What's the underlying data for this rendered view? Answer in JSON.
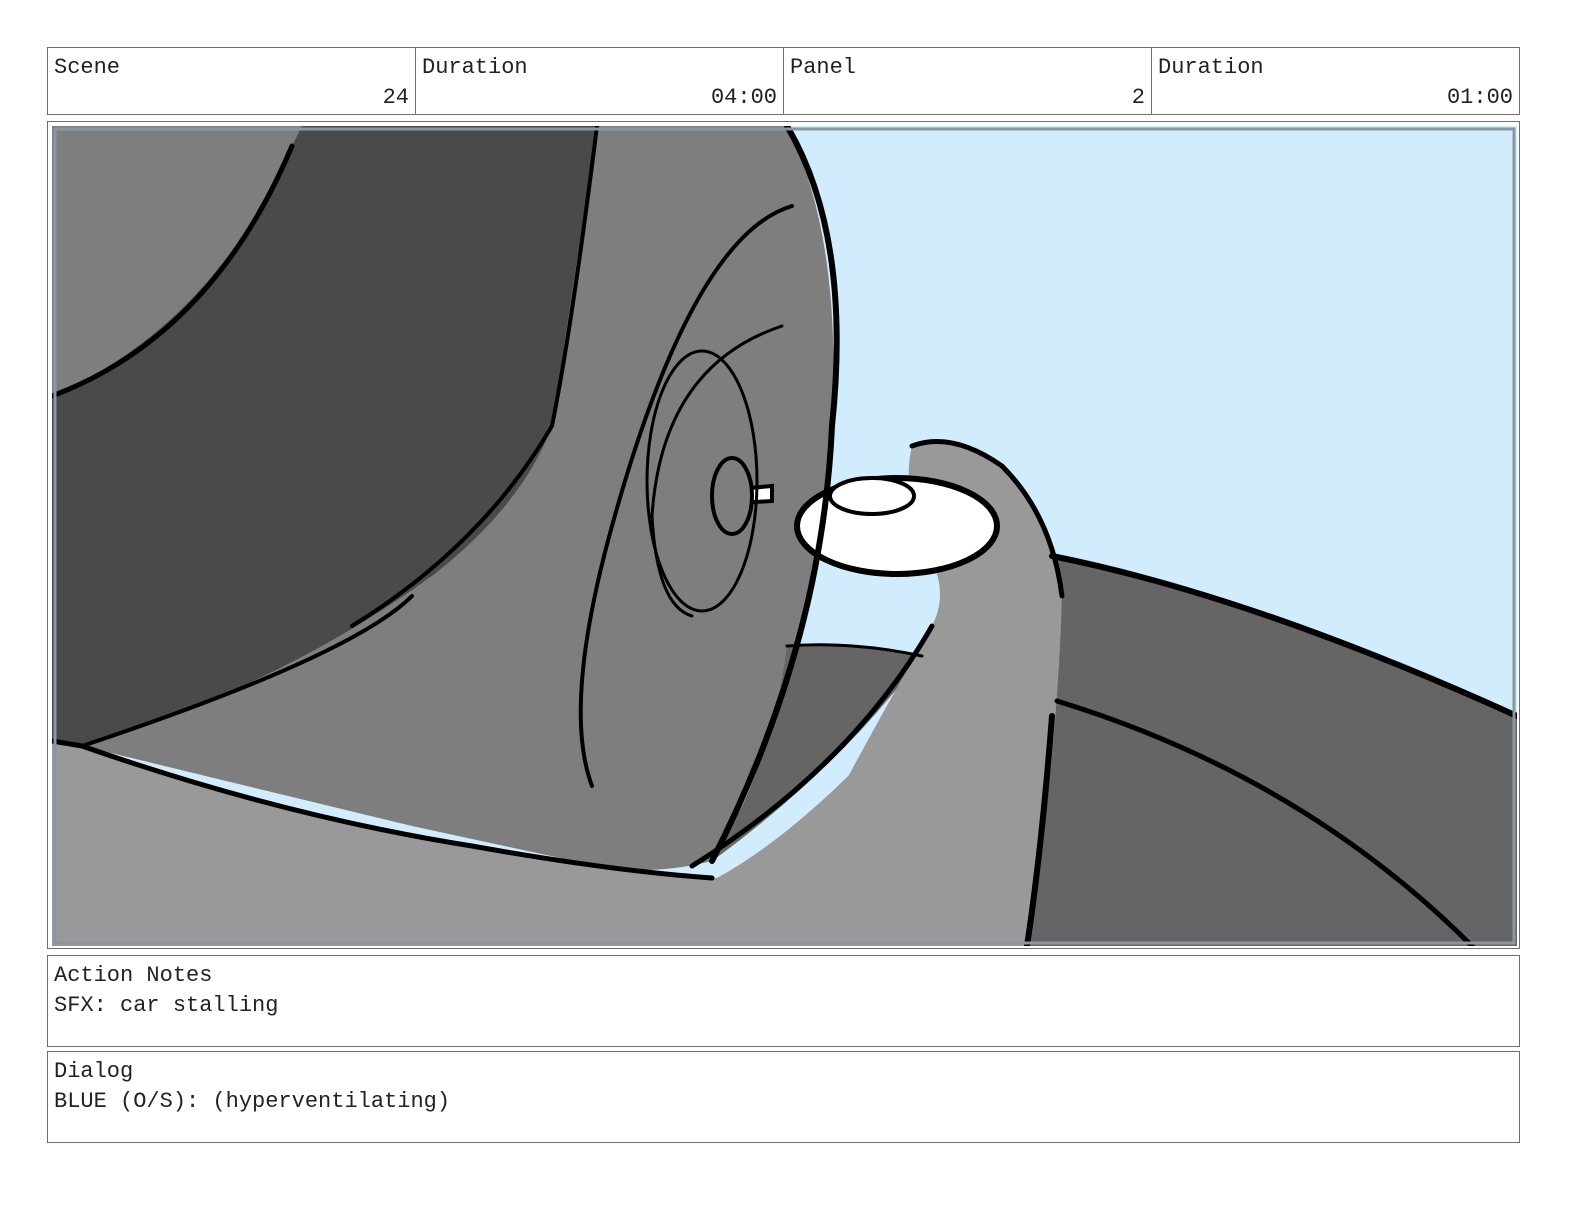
{
  "header": {
    "scene_label": "Scene",
    "scene_value": "24",
    "scene_duration_label": "Duration",
    "scene_duration_value": "04:00",
    "panel_label": "Panel",
    "panel_value": "2",
    "panel_duration_label": "Duration",
    "panel_duration_value": "01:00"
  },
  "panel": {
    "image": "storyboard-drawing-hand-turning-car-key-in-ignition"
  },
  "action_notes": {
    "label": "Action Notes",
    "text": "SFX: car stalling"
  },
  "dialog": {
    "label": "Dialog",
    "text": "BLUE (O/S): (hyperventilating)"
  },
  "colors": {
    "sky": "#d1ecfc",
    "dark_gray": "#4a4a4a",
    "mid_gray": "#7e7e7e",
    "light_gray": "#999999",
    "shadow_gray": "#656565",
    "ink": "#000000",
    "border": "#6e6e6e"
  }
}
